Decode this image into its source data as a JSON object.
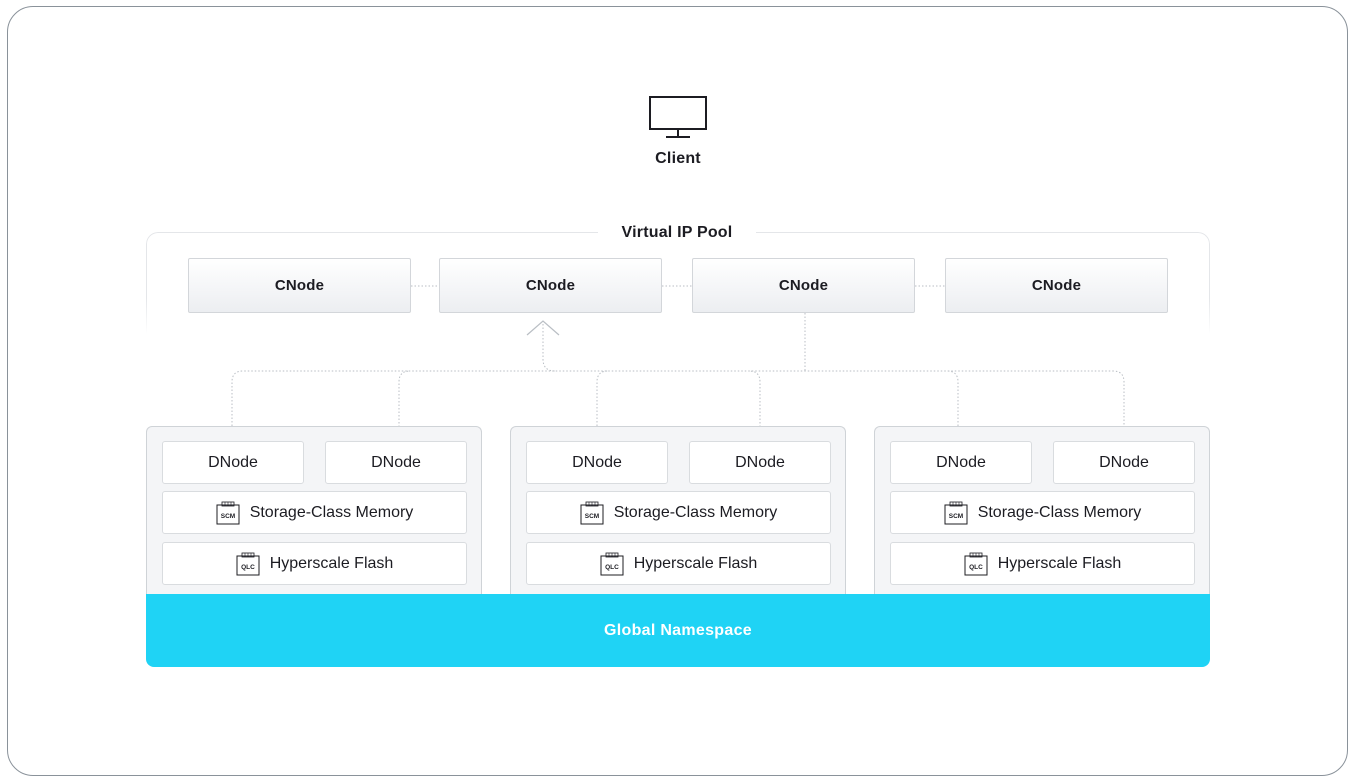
{
  "client": {
    "label": "Client",
    "icon": "monitor-icon"
  },
  "pool": {
    "title": "Virtual IP Pool"
  },
  "cnodes": [
    {
      "label": "CNode"
    },
    {
      "label": "CNode"
    },
    {
      "label": "CNode"
    },
    {
      "label": "CNode"
    }
  ],
  "dboxes": [
    {
      "dnodes": [
        "DNode",
        "DNode"
      ],
      "scm": {
        "label": "Storage-Class Memory",
        "chip": "SCM"
      },
      "flash": {
        "label": "Hyperscale Flash",
        "chip": "QLC"
      }
    },
    {
      "dnodes": [
        "DNode",
        "DNode"
      ],
      "scm": {
        "label": "Storage-Class Memory",
        "chip": "SCM"
      },
      "flash": {
        "label": "Hyperscale Flash",
        "chip": "QLC"
      }
    },
    {
      "dnodes": [
        "DNode",
        "DNode"
      ],
      "scm": {
        "label": "Storage-Class Memory",
        "chip": "SCM"
      },
      "flash": {
        "label": "Hyperscale Flash",
        "chip": "QLC"
      }
    }
  ],
  "global": {
    "label": "Global Namespace"
  },
  "colors": {
    "accent": "#1fd3f5",
    "border": "#8a929a",
    "text": "#1c1c22"
  }
}
